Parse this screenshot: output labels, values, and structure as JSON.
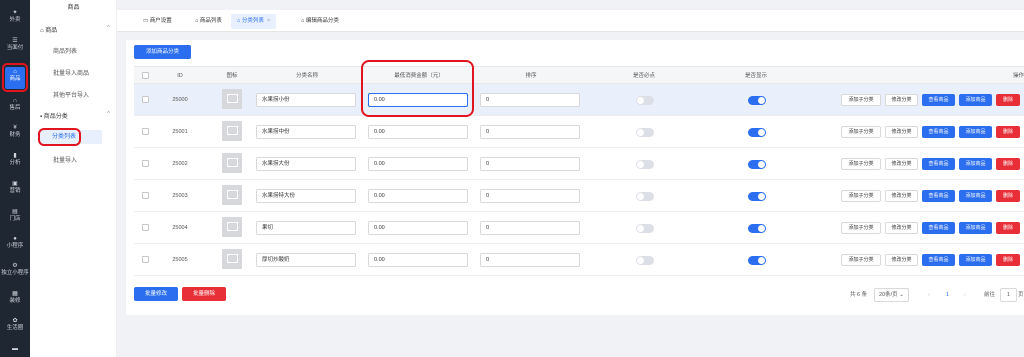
{
  "rail": {
    "items": [
      {
        "label": "外卖",
        "icon": "bike-icon"
      },
      {
        "label": "当面付",
        "icon": "list-icon"
      },
      {
        "label": "商品",
        "icon": "shop-icon"
      },
      {
        "label": "售后",
        "icon": "headset-icon"
      },
      {
        "label": "财务",
        "icon": "money-icon"
      },
      {
        "label": "分析",
        "icon": "chart-icon"
      },
      {
        "label": "营销",
        "icon": "gift-icon"
      },
      {
        "label": "门店",
        "icon": "store-icon"
      },
      {
        "label": "小程序",
        "icon": "cloud-icon"
      },
      {
        "label": "独立小程序",
        "icon": "gear-icon"
      },
      {
        "label": "装修",
        "icon": "brush-icon"
      },
      {
        "label": "生活圈",
        "icon": "settings-icon"
      }
    ]
  },
  "subnav": {
    "header": "商品",
    "group1": "商品",
    "group1_items": [
      "商品列表",
      "批量导入商品",
      "其他平台导入"
    ],
    "group2": "商品分类",
    "group2_items": [
      "分类列表",
      "批量导入"
    ]
  },
  "tabs": [
    "商户设置",
    "商品列表",
    "分类列表",
    "编辑商品分类"
  ],
  "toolbar": {
    "add_button": "添加商品分类"
  },
  "columns": [
    "ID",
    "图标",
    "分类名称",
    "最低消费金额（元）",
    "排序",
    "是否必点",
    "是否显示",
    "操作"
  ],
  "rows": [
    {
      "id": "25000",
      "name": "水果捞小份",
      "min": "0.00",
      "sort": "0",
      "required": false,
      "visible": true
    },
    {
      "id": "25001",
      "name": "水果捞中份",
      "min": "0.00",
      "sort": "0",
      "required": false,
      "visible": true
    },
    {
      "id": "25002",
      "name": "水果捞大份",
      "min": "0.00",
      "sort": "0",
      "required": false,
      "visible": true
    },
    {
      "id": "25003",
      "name": "水果捞特大份",
      "min": "0.00",
      "sort": "0",
      "required": false,
      "visible": true
    },
    {
      "id": "25004",
      "name": "果切",
      "min": "0.00",
      "sort": "0",
      "required": false,
      "visible": true
    },
    {
      "id": "25005",
      "name": "厚切炒酸奶",
      "min": "0.00",
      "sort": "0",
      "required": false,
      "visible": true
    }
  ],
  "row_actions": [
    "添加子分类",
    "修改分类",
    "查看商品",
    "添加商品",
    "删除"
  ],
  "footer": {
    "batch_edit": "批量修改",
    "batch_delete": "批量删除",
    "total": "共 6 条",
    "page_size": "20条/页",
    "page": "1",
    "goto_label": "前往",
    "goto_value": "1",
    "goto_suffix": "页"
  }
}
